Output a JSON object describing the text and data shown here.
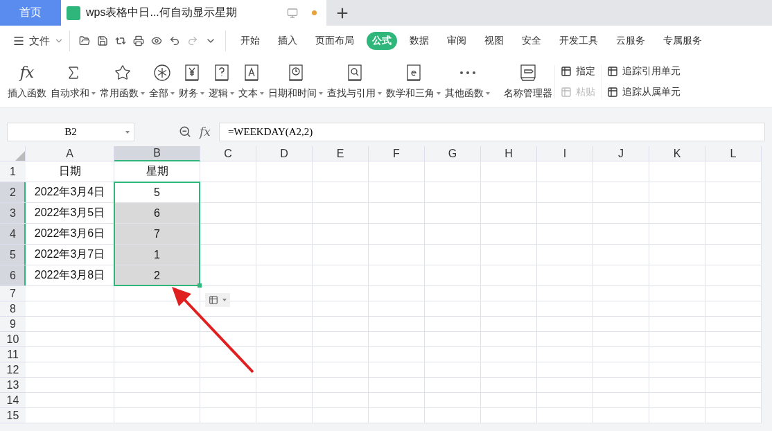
{
  "tabs": [
    {
      "label": "首页",
      "kind": "home",
      "selected": false
    },
    {
      "label": "wps表格中日...何自动显示星期",
      "kind": "doc",
      "selected": true,
      "unsaved": true
    }
  ],
  "menu": {
    "file": "文件",
    "items": [
      {
        "label": "开始",
        "selected": false
      },
      {
        "label": "插入",
        "selected": false
      },
      {
        "label": "页面布局",
        "selected": false
      },
      {
        "label": "公式",
        "selected": true
      },
      {
        "label": "数据",
        "selected": false
      },
      {
        "label": "审阅",
        "selected": false
      },
      {
        "label": "视图",
        "selected": false
      },
      {
        "label": "安全",
        "selected": false
      },
      {
        "label": "开发工具",
        "selected": false
      },
      {
        "label": "云服务",
        "selected": false
      },
      {
        "label": "专属服务",
        "selected": false
      }
    ]
  },
  "ribbon": [
    {
      "label": "插入函数",
      "glyph": "fx",
      "dropdown": false
    },
    {
      "label": "自动求和",
      "dropdown": true
    },
    {
      "label": "常用函数",
      "dropdown": true
    },
    {
      "label": "全部",
      "dropdown": true
    },
    {
      "label": "财务",
      "dropdown": true
    },
    {
      "label": "逻辑",
      "dropdown": true
    },
    {
      "label": "文本",
      "dropdown": true
    },
    {
      "label": "日期和时间",
      "dropdown": true
    },
    {
      "label": "查找与引用",
      "dropdown": true
    },
    {
      "label": "数学和三角",
      "dropdown": true
    },
    {
      "label": "其他函数",
      "dropdown": true
    },
    {
      "label": "名称管理器",
      "dropdown": false
    }
  ],
  "ribbon_small": [
    [
      {
        "label": "指定",
        "disabled": false
      },
      {
        "label": "粘贴",
        "disabled": true
      }
    ],
    [
      {
        "label": "追踪引用单元",
        "disabled": false
      },
      {
        "label": "追踪从属单元",
        "disabled": false
      }
    ]
  ],
  "formula_bar": {
    "name_box": "B2",
    "fx": "fx",
    "formula": "=WEEKDAY(A2,2)"
  },
  "sheet": {
    "columns": [
      {
        "label": "A",
        "selected": false
      },
      {
        "label": "B",
        "selected": true
      },
      {
        "label": "C",
        "selected": false
      },
      {
        "label": "D",
        "selected": false
      },
      {
        "label": "E",
        "selected": false
      },
      {
        "label": "F",
        "selected": false
      },
      {
        "label": "G",
        "selected": false
      },
      {
        "label": "H",
        "selected": false
      },
      {
        "label": "I",
        "selected": false
      },
      {
        "label": "J",
        "selected": false
      },
      {
        "label": "K",
        "selected": false
      },
      {
        "label": "L",
        "selected": false
      }
    ],
    "rows": [
      {
        "label": "1",
        "selected": false,
        "cells": [
          "日期",
          "星期"
        ]
      },
      {
        "label": "2",
        "selected": true,
        "cells": [
          "2022年3月4日",
          "5"
        ]
      },
      {
        "label": "3",
        "selected": true,
        "cells": [
          "2022年3月5日",
          "6"
        ]
      },
      {
        "label": "4",
        "selected": true,
        "cells": [
          "2022年3月6日",
          "7"
        ]
      },
      {
        "label": "5",
        "selected": true,
        "cells": [
          "2022年3月7日",
          "1"
        ]
      },
      {
        "label": "6",
        "selected": true,
        "cells": [
          "2022年3月8日",
          "2"
        ]
      },
      {
        "label": "7",
        "selected": false,
        "cells": []
      },
      {
        "label": "8",
        "selected": false,
        "cells": []
      },
      {
        "label": "9",
        "selected": false,
        "cells": []
      },
      {
        "label": "10",
        "selected": false,
        "cells": []
      },
      {
        "label": "11",
        "selected": false,
        "cells": []
      },
      {
        "label": "12",
        "selected": false,
        "cells": []
      },
      {
        "label": "13",
        "selected": false,
        "cells": []
      },
      {
        "label": "14",
        "selected": false,
        "cells": []
      },
      {
        "label": "15",
        "selected": false,
        "cells": []
      }
    ]
  }
}
